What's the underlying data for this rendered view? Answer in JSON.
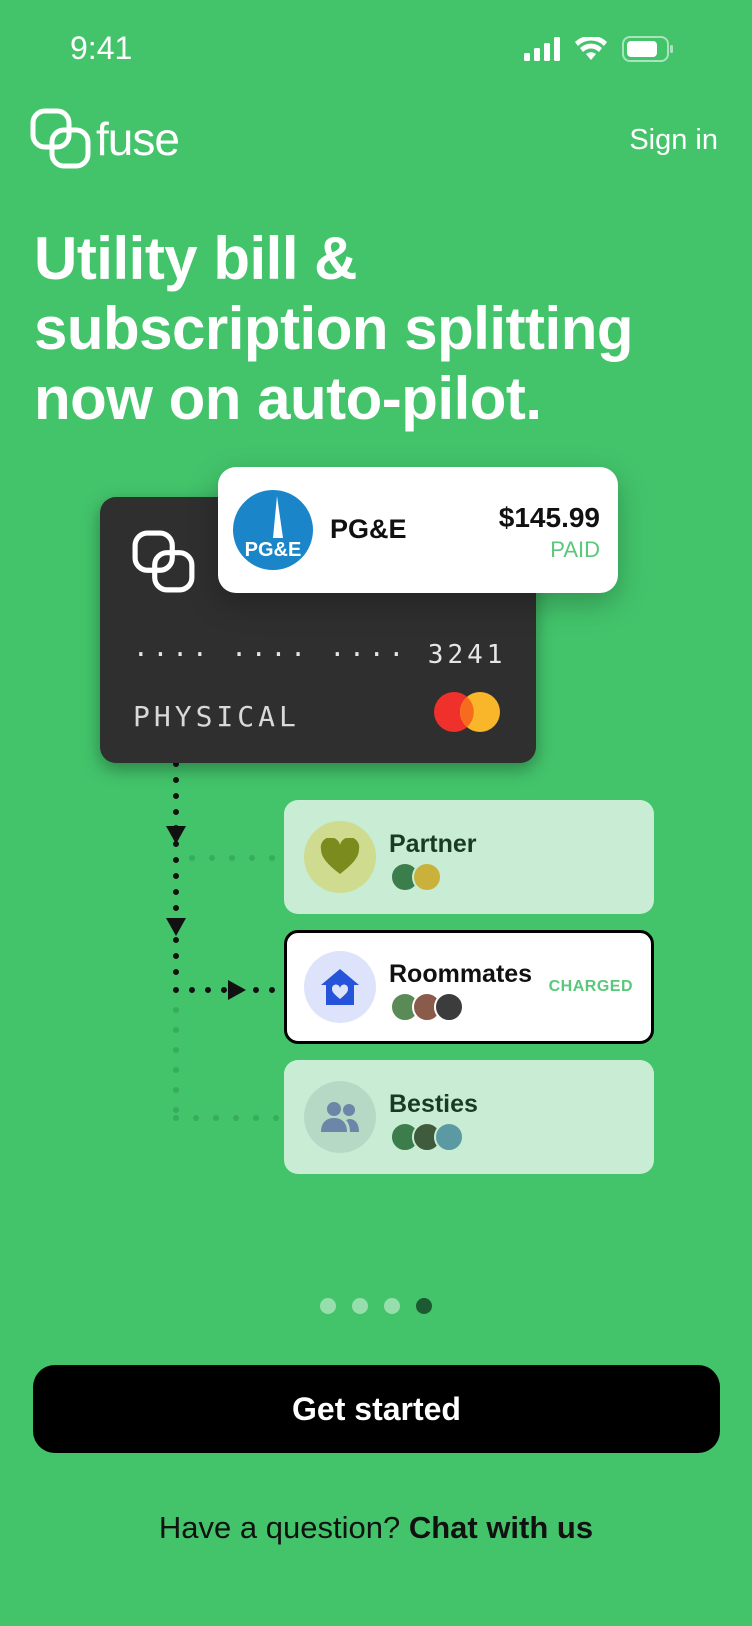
{
  "status_bar": {
    "time": "9:41"
  },
  "header": {
    "logo_text": "fuse",
    "sign_in": "Sign in"
  },
  "headline": "Utility bill & subscription splitting now on auto-pilot.",
  "card": {
    "number": "···· ···· ···· 3241",
    "label": "PHYSICAL"
  },
  "bill": {
    "logo_text": "PG&E",
    "name": "PG&E",
    "amount": "$145.99",
    "status": "PAID"
  },
  "groups": [
    {
      "name": "Partner",
      "icon": "heart-icon",
      "status": ""
    },
    {
      "name": "Roommates",
      "icon": "house-icon",
      "status": "CHARGED"
    },
    {
      "name": "Besties",
      "icon": "people-icon",
      "status": ""
    }
  ],
  "pagination": {
    "count": 4,
    "active_index": 3
  },
  "cta": {
    "label": "Get started"
  },
  "help": {
    "question": "Have a question?",
    "link": "Chat with us"
  },
  "colors": {
    "background": "#43c46b",
    "card": "#2f2f2f",
    "accent_green": "#5ac77a",
    "cta": "#000000"
  }
}
